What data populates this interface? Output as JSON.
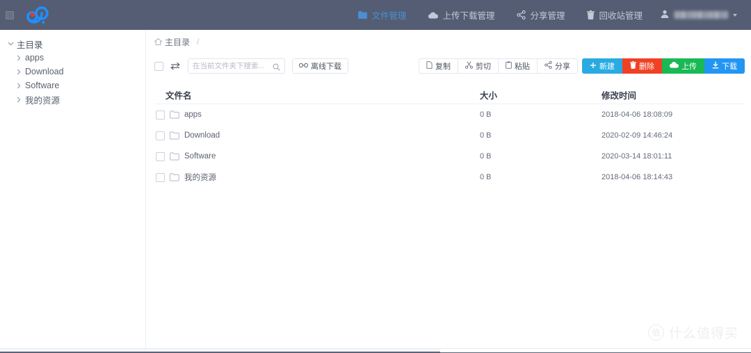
{
  "header": {
    "logo_name": "baidu-cloud-logo",
    "nav": [
      {
        "label": "文件管理",
        "icon": "folder-icon",
        "active": true
      },
      {
        "label": "上传下载管理",
        "icon": "cloud-icon",
        "active": false
      },
      {
        "label": "分享管理",
        "icon": "share-icon",
        "active": false
      },
      {
        "label": "回收站管理",
        "icon": "trash-icon",
        "active": false
      }
    ],
    "user": {
      "icon": "user-icon",
      "name_masked": "",
      "caret": "chevron-down-icon"
    },
    "colors": {
      "bar": "#545d73",
      "active_nav": "#4a8fd4",
      "nav_text": "#c3c8d4"
    }
  },
  "sidebar": {
    "items": [
      {
        "label": "主目录",
        "level": 0,
        "expanded": true,
        "chevron": "chevron-down-icon"
      },
      {
        "label": "apps",
        "level": 1,
        "expanded": false,
        "chevron": "chevron-right-icon"
      },
      {
        "label": "Download",
        "level": 1,
        "expanded": false,
        "chevron": "chevron-right-icon"
      },
      {
        "label": "Software",
        "level": 1,
        "expanded": false,
        "chevron": "chevron-right-icon"
      },
      {
        "label": "我的资源",
        "level": 1,
        "expanded": false,
        "chevron": "chevron-right-icon"
      }
    ]
  },
  "breadcrumb": {
    "home_icon": "home-icon",
    "path": "主目录",
    "separator": "/"
  },
  "toolbar": {
    "select_all_checkbox": "",
    "sort_icon": "swap-arrows-icon",
    "search": {
      "value": "",
      "placeholder": "在当前文件夹下搜索..."
    },
    "offline_download": {
      "label": "离线下载",
      "icon": "link-icon"
    },
    "plain_buttons": [
      {
        "label": "复制",
        "icon": "copy-icon"
      },
      {
        "label": "剪切",
        "icon": "scissors-icon"
      },
      {
        "label": "粘贴",
        "icon": "clipboard-icon"
      },
      {
        "label": "分享",
        "icon": "share-icon"
      }
    ],
    "color_buttons": [
      {
        "label": "新建",
        "icon": "plus-icon",
        "color": "#29abe2"
      },
      {
        "label": "删除",
        "icon": "trash-icon",
        "color": "#f04124"
      },
      {
        "label": "上传",
        "icon": "cloud-upload-icon",
        "color": "#19b955"
      },
      {
        "label": "下载",
        "icon": "download-icon",
        "color": "#2196f3"
      }
    ]
  },
  "table": {
    "columns": [
      "文件名",
      "大小",
      "修改时间"
    ],
    "rows": [
      {
        "name": "apps",
        "size": "0 B",
        "modified": "2018-04-06 18:08:09",
        "icon": "folder-icon"
      },
      {
        "name": "Download",
        "size": "0 B",
        "modified": "2020-02-09 14:46:24",
        "icon": "folder-icon"
      },
      {
        "name": "Software",
        "size": "0 B",
        "modified": "2020-03-14 18:01:11",
        "icon": "folder-icon"
      },
      {
        "name": "我的资源",
        "size": "0 B",
        "modified": "2018-04-06 18:14:43",
        "icon": "folder-icon"
      }
    ]
  },
  "watermark": {
    "mark": "值",
    "text": "什么值得买"
  }
}
